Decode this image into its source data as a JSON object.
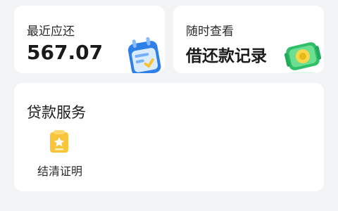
{
  "repayment_card": {
    "label": "最近应还",
    "amount": "567.07",
    "icon": "calendar-icon"
  },
  "records_card": {
    "label": "随时查看",
    "title": "借还款记录",
    "icon": "money-icon"
  },
  "loan_services": {
    "title": "贷款服务",
    "items": [
      {
        "label": "结清证明",
        "icon": "certificate-icon"
      }
    ]
  },
  "colors": {
    "background": "#f2f3f5",
    "card": "#ffffff",
    "calendar_blue": "#3b8df2",
    "money_green": "#41c977",
    "certificate_yellow": "#f8c53a"
  }
}
